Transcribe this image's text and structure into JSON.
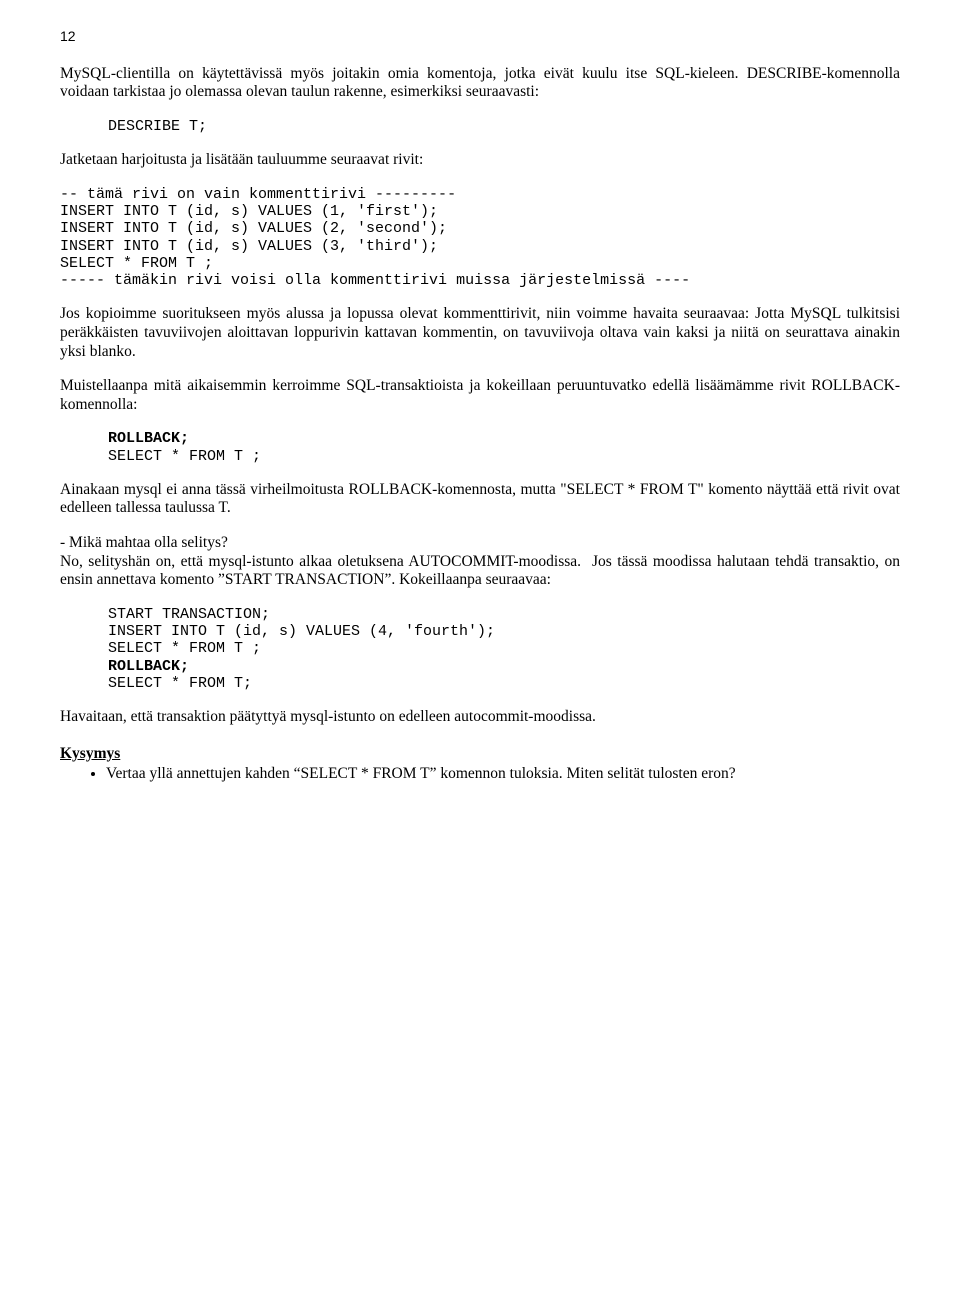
{
  "page": {
    "number": "12"
  },
  "p1": "MySQL-clientilla on käytettävissä myös joitakin omia komentoja, jotka eivät kuulu itse SQL-kieleen. DESCRIBE-komennolla voidaan tarkistaa jo olemassa olevan taulun rakenne, esimerkiksi seuraavasti:",
  "code1": "DESCRIBE T;",
  "p2": "Jatketaan harjoitusta ja lisätään tauluumme seuraavat rivit:",
  "code2": "-- tämä rivi on vain kommenttirivi ---------\nINSERT INTO T (id, s) VALUES (1, 'first');\nINSERT INTO T (id, s) VALUES (2, 'second');\nINSERT INTO T (id, s) VALUES (3, 'third');\nSELECT * FROM T ;\n----- tämäkin rivi voisi olla kommenttirivi muissa järjestelmissä ----",
  "p3": "Jos kopioimme suoritukseen myös alussa ja lopussa olevat kommenttirivit, niin voimme havaita seuraavaa: Jotta MySQL tulkitsisi peräkkäisten tavuviivojen aloittavan loppurivin kattavan kommentin, on tavuviivoja oltava vain kaksi ja niitä on seurattava ainakin yksi blanko.",
  "p4": "Muistellaanpa mitä aikaisemmin kerroimme SQL-transaktioista ja kokeillaan peruuntuvatko edellä lisäämämme rivit ROLLBACK-komennolla:",
  "code3_line1": "ROLLBACK;",
  "code3_line2": "SELECT * FROM T ;",
  "p5": "Ainakaan mysql ei anna tässä virheilmoitusta ROLLBACK-komennosta, mutta \"SELECT * FROM T\" komento näyttää että rivit ovat edelleen tallessa taulussa T.",
  "p6": "- Mikä mahtaa olla selitys?\nNo, selityshän on, että mysql-istunto alkaa oletuksena AUTOCOMMIT-moodissa.  Jos tässä moodissa halutaan tehdä transaktio, on ensin annettava komento ”START TRANSACTION”. Kokeillaanpa seuraavaa:",
  "code4_line1": "START TRANSACTION;",
  "code4_line2": "INSERT INTO T (id, s) VALUES (4, 'fourth');",
  "code4_line3": "SELECT * FROM T ;",
  "code4_line4": "ROLLBACK;",
  "code4_line5": "SELECT * FROM T;",
  "p7": "Havaitaan, että transaktion päätyttyä mysql-istunto on edelleen autocommit-moodissa.",
  "q_heading": "Kysymys",
  "q_bullet": "Vertaa yllä annettujen kahden “SELECT * FROM T” komennon tuloksia.  Miten selität tulosten eron?"
}
